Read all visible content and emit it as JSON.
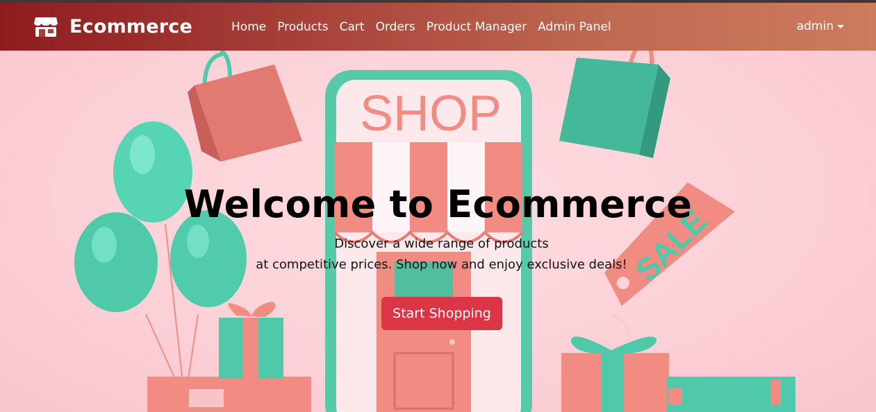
{
  "brand": {
    "name": "Ecommerce",
    "icon": "storefront-icon"
  },
  "nav": {
    "links": [
      "Home",
      "Products",
      "Cart",
      "Orders",
      "Product Manager",
      "Admin Panel"
    ],
    "user": "admin"
  },
  "hero": {
    "title": "Welcome to Ecommerce",
    "subtitle_line1": "Discover a wide range of products",
    "subtitle_line2": "at competitive prices. Shop now and enjoy exclusive deals!",
    "cta_label": "Start Shopping",
    "illustration": {
      "shop_sign": "SHOP",
      "tag_text": "SALE"
    }
  },
  "colors": {
    "navbar_start": "#8e1c1f",
    "navbar_end": "#cc7b5d",
    "hero_bg": "#fbd3d8",
    "cta": "#dc3545",
    "teal": "#4fc9a9",
    "coral": "#f28b82"
  }
}
